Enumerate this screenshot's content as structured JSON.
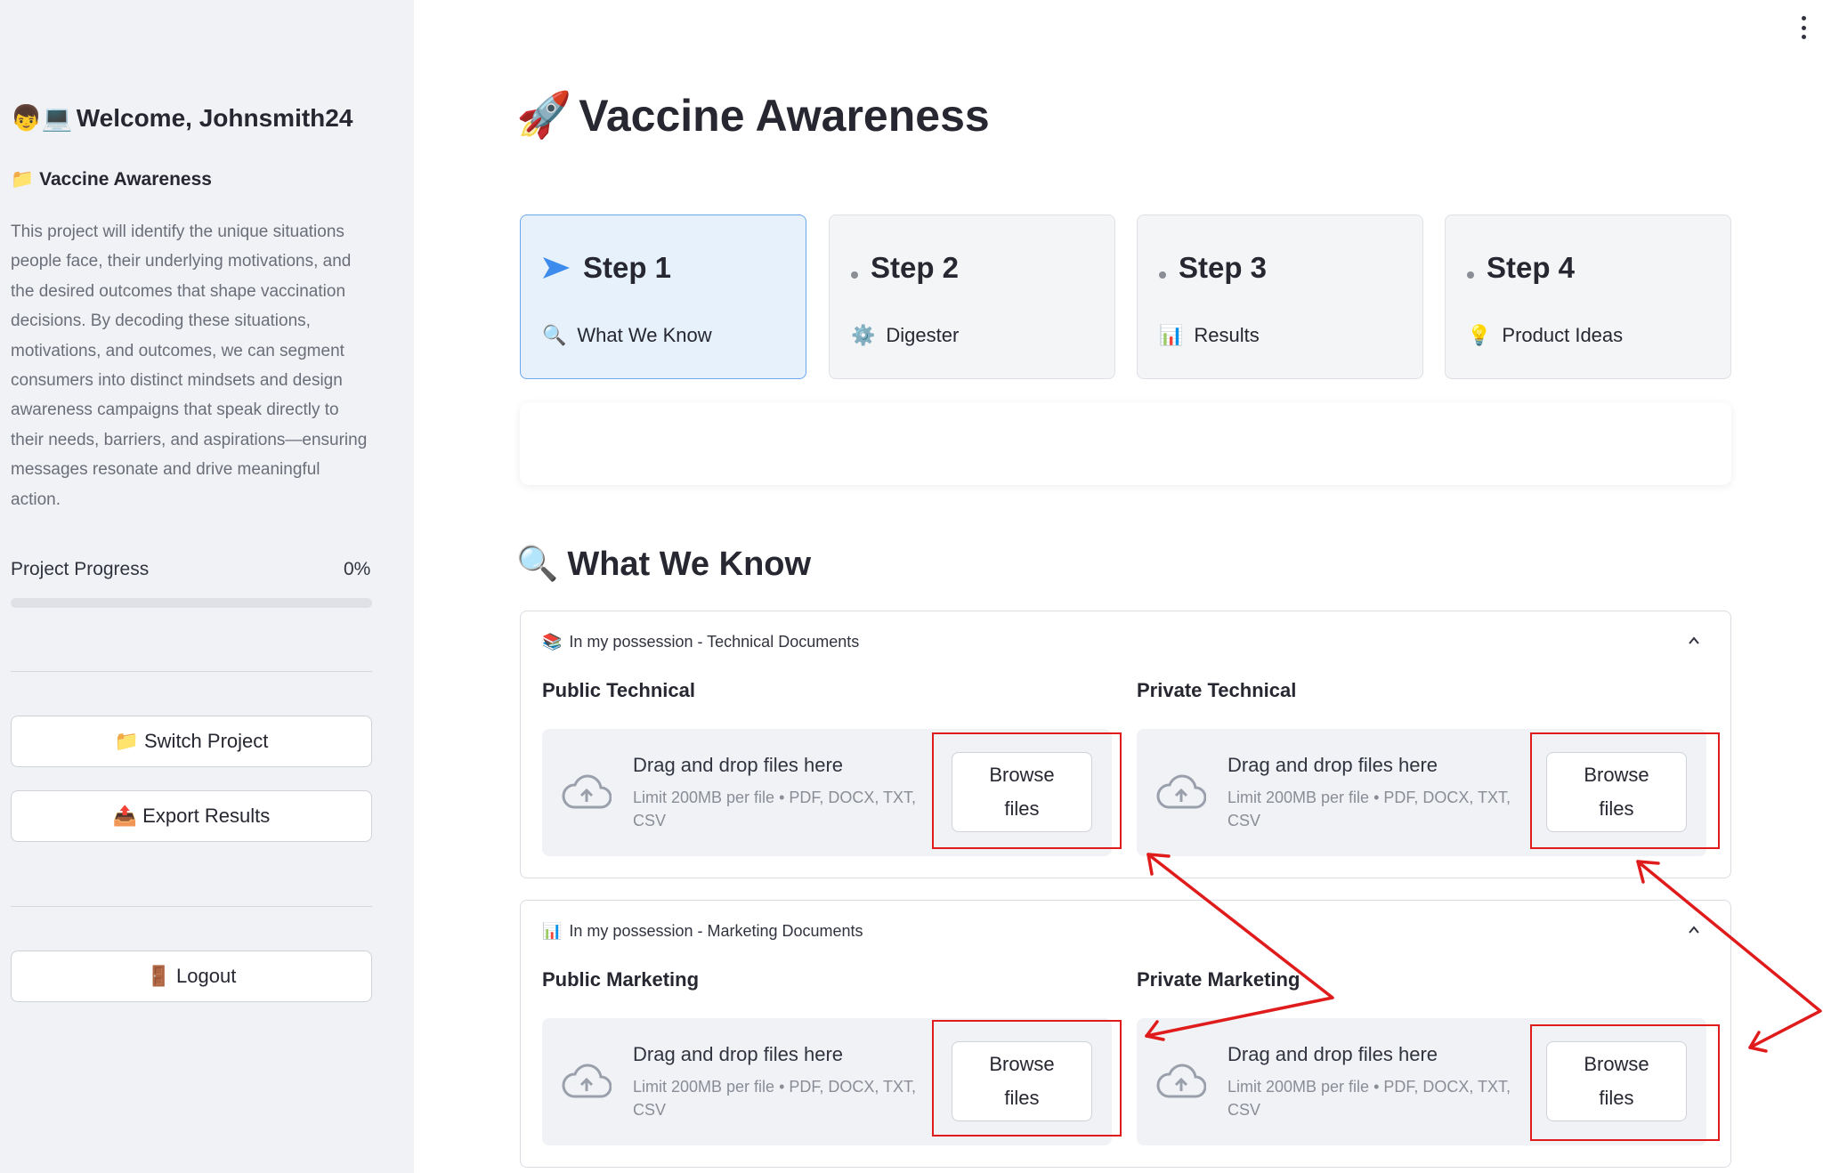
{
  "sidebar": {
    "welcome_icons": "👦💻",
    "welcome": "Welcome, Johnsmith24",
    "project_icon": "📁",
    "project_name": "Vaccine Awareness",
    "project_description": "This project will identify the unique situations people face, their underlying motivations, and the desired outcomes that shape vaccination decisions. By decoding these situations, motivations, and outcomes, we can segment consumers into distinct mindsets and design awareness campaigns that speak directly to their needs, barriers, and aspirations—ensuring messages resonate and drive meaningful action.",
    "progress_label": "Project Progress",
    "progress_value": "0%",
    "progress_fraction": 0,
    "switch_icon": "📁",
    "switch_label": "Switch Project",
    "export_icon": "📤",
    "export_label": "Export Results",
    "logout_icon": "🚪",
    "logout_label": "Logout"
  },
  "main": {
    "title_icon": "🚀",
    "title": "Vaccine Awareness",
    "steps": [
      {
        "label": "Step 1",
        "icon": "🔍",
        "sub": "What We Know",
        "active": true
      },
      {
        "label": "Step 2",
        "icon": "⚙️",
        "sub": "Digester",
        "active": false
      },
      {
        "label": "Step 3",
        "icon": "📊",
        "sub": "Results",
        "active": false
      },
      {
        "label": "Step 4",
        "icon": "💡",
        "sub": "Product Ideas",
        "active": false
      }
    ],
    "section_icon": "🔍",
    "section_title": "What We Know",
    "expanders": [
      {
        "icon": "📚",
        "title": "In my possession - Technical Documents",
        "columns": [
          {
            "title": "Public Technical"
          },
          {
            "title": "Private Technical"
          }
        ]
      },
      {
        "icon": "📊",
        "title": "In my possession - Marketing Documents",
        "columns": [
          {
            "title": "Public Marketing"
          },
          {
            "title": "Private Marketing"
          }
        ]
      }
    ],
    "uploader": {
      "drag_text": "Drag and drop files here",
      "limit_text": "Limit 200MB per file • PDF, DOCX, TXT, CSV",
      "browse_line1": "Browse",
      "browse_line2": "files"
    }
  },
  "colors": {
    "accent": "#ff4b4b",
    "active_step_bg": "#e7f1fc",
    "active_step_border": "#6aa8ee",
    "annotation_red": "#e01b1b",
    "step1_arrow": "#3d8bec"
  }
}
